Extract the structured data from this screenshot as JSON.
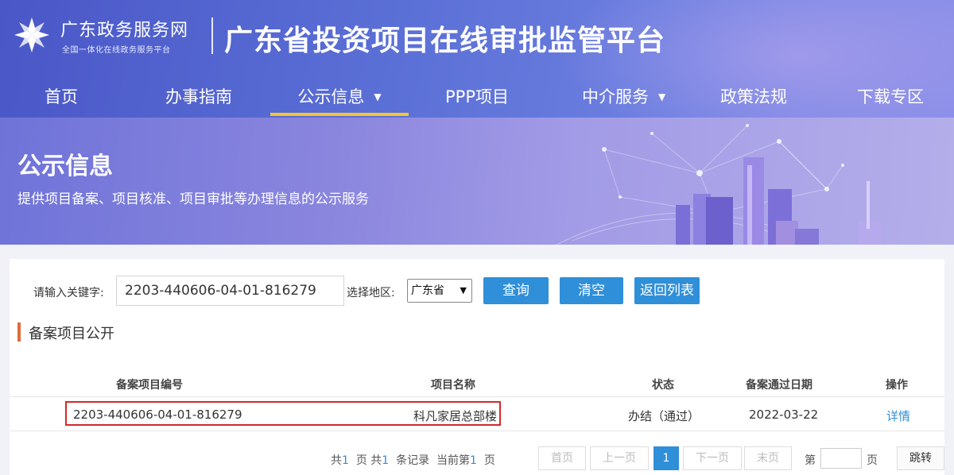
{
  "header": {
    "brand_name": "广东政务服务网",
    "brand_sub": "全国一体化在线政务服务平台",
    "site_title": "广东省投资项目在线审批监管平台",
    "nav": [
      {
        "label": "首页"
      },
      {
        "label": "办事指南"
      },
      {
        "label": "公示信息",
        "active": true,
        "dropdown": true
      },
      {
        "label": "PPP项目"
      },
      {
        "label": "中介服务",
        "dropdown": true
      },
      {
        "label": "政策法规"
      },
      {
        "label": "下载专区"
      }
    ],
    "dropdown_glyph": "▼"
  },
  "banner": {
    "title": "公示信息",
    "subtitle": "提供项目备案、项目核准、项目审批等办理信息的公示服务"
  },
  "search": {
    "keyword_label": "请输入关键字:",
    "keyword_value": "2203-440606-04-01-816279",
    "region_label": "选择地区:",
    "region_value": "广东省",
    "buttons": {
      "query": "查询",
      "clear": "清空",
      "back": "返回列表"
    }
  },
  "section": {
    "title": "备案项目公开"
  },
  "table": {
    "headers": [
      "备案项目编号",
      "项目名称",
      "状态",
      "备案通过日期",
      "操作"
    ],
    "rows": [
      {
        "code": "2203-440606-04-01-816279",
        "name": "科凡家居总部楼",
        "status": "办结（通过）",
        "date": "2022-03-22",
        "action": "详情"
      }
    ]
  },
  "pager": {
    "total_pages_prefix": "共",
    "total_pages": "1",
    "total_pages_suffix": "页",
    "total_records_prefix": "共",
    "total_records": "1",
    "total_records_suffix": "条记录",
    "current_prefix": "当前第",
    "current": "1",
    "current_suffix": "页",
    "first": "首页",
    "prev": "上一页",
    "page": "1",
    "next": "下一页",
    "last": "末页",
    "jump_prefix": "第",
    "jump_suffix": "页",
    "go": "跳转"
  },
  "colors": {
    "primary": "#2f8fd8",
    "nav_active": "#f4c531",
    "highlight": "#d12a2a",
    "accent": "#e06a3b"
  }
}
